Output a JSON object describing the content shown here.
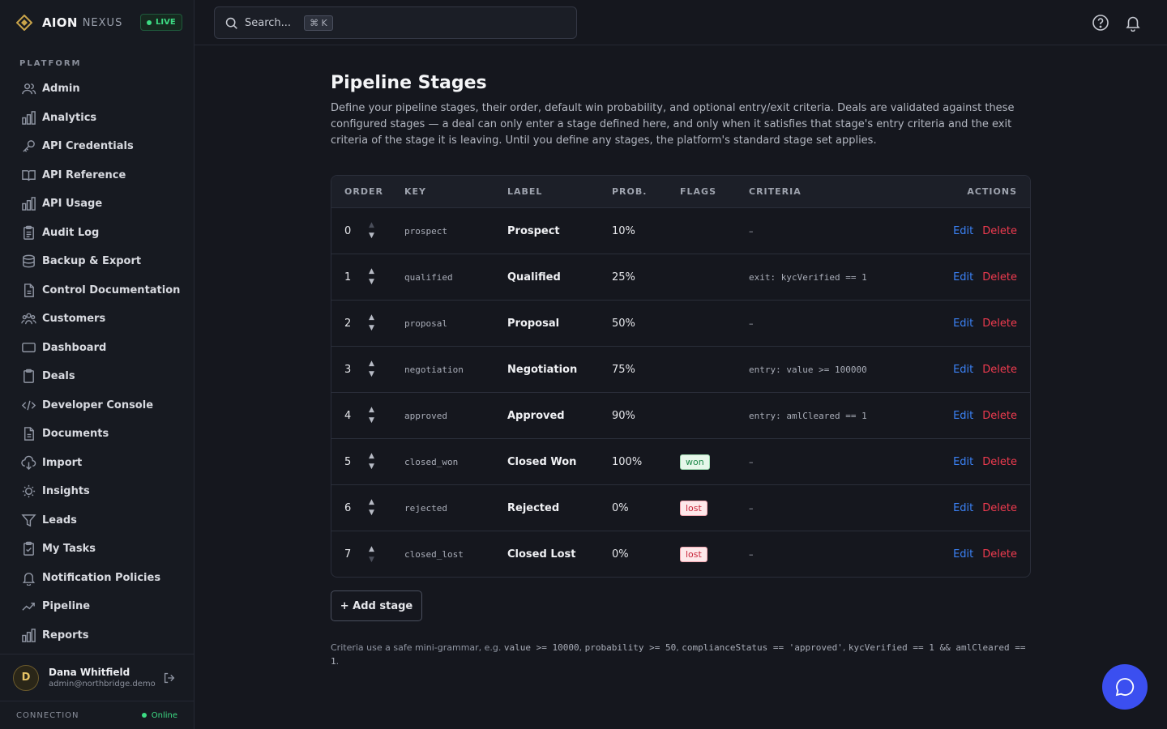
{
  "brand": {
    "name": "AION",
    "sub": "NEXUS",
    "live": "LIVE"
  },
  "sidebar": {
    "section": "PLATFORM",
    "items": [
      {
        "label": "Admin",
        "icon": "users-icon"
      },
      {
        "label": "Analytics",
        "icon": "bar-chart-icon"
      },
      {
        "label": "API Credentials",
        "icon": "key-icon"
      },
      {
        "label": "API Reference",
        "icon": "book-icon"
      },
      {
        "label": "API Usage",
        "icon": "bar-chart-icon"
      },
      {
        "label": "Audit Log",
        "icon": "clipboard-icon"
      },
      {
        "label": "Backup & Export",
        "icon": "database-icon"
      },
      {
        "label": "Control Documentation",
        "icon": "file-icon"
      },
      {
        "label": "Customers",
        "icon": "group-icon"
      },
      {
        "label": "Dashboard",
        "icon": "monitor-icon"
      },
      {
        "label": "Deals",
        "icon": "clipboard-icon"
      },
      {
        "label": "Developer Console",
        "icon": "code-icon"
      },
      {
        "label": "Documents",
        "icon": "file-icon"
      },
      {
        "label": "Import",
        "icon": "cloud-download-icon"
      },
      {
        "label": "Insights",
        "icon": "lightbulb-icon"
      },
      {
        "label": "Leads",
        "icon": "funnel-icon"
      },
      {
        "label": "My Tasks",
        "icon": "clipboard-check-icon"
      },
      {
        "label": "Notification Policies",
        "icon": "bell-icon"
      },
      {
        "label": "Pipeline",
        "icon": "trending-icon"
      },
      {
        "label": "Reports",
        "icon": "bar-chart-icon"
      }
    ]
  },
  "user": {
    "initial": "D",
    "name": "Dana Whitfield",
    "email": "admin@northbridge.demo"
  },
  "connection": {
    "label": "CONNECTION",
    "status": "Online"
  },
  "search": {
    "placeholder": "Search...",
    "shortcut": "⌘ K"
  },
  "page": {
    "title": "Pipeline Stages",
    "description": "Define your pipeline stages, their order, default win probability, and optional entry/exit criteria. Deals are validated against these configured stages — a deal can only enter a stage defined here, and only when it satisfies that stage's entry criteria and the exit criteria of the stage it is leaving. Until you define any stages, the platform's standard stage set applies."
  },
  "table": {
    "headers": {
      "order": "ORDER",
      "key": "KEY",
      "label": "LABEL",
      "prob": "PROB.",
      "flags": "FLAGS",
      "criteria": "CRITERIA",
      "actions": "ACTIONS"
    },
    "edit_label": "Edit",
    "delete_label": "Delete",
    "up_arrow": "▲",
    "down_arrow": "▼",
    "rows": [
      {
        "order": "0",
        "key": "prospect",
        "label": "Prospect",
        "prob": "10%",
        "flag": "",
        "criteria": "–"
      },
      {
        "order": "1",
        "key": "qualified",
        "label": "Qualified",
        "prob": "25%",
        "flag": "",
        "criteria": "exit: kycVerified == 1"
      },
      {
        "order": "2",
        "key": "proposal",
        "label": "Proposal",
        "prob": "50%",
        "flag": "",
        "criteria": "–"
      },
      {
        "order": "3",
        "key": "negotiation",
        "label": "Negotiation",
        "prob": "75%",
        "flag": "",
        "criteria": "entry: value >= 100000"
      },
      {
        "order": "4",
        "key": "approved",
        "label": "Approved",
        "prob": "90%",
        "flag": "",
        "criteria": "entry: amlCleared == 1"
      },
      {
        "order": "5",
        "key": "closed_won",
        "label": "Closed Won",
        "prob": "100%",
        "flag": "won",
        "criteria": "–"
      },
      {
        "order": "6",
        "key": "rejected",
        "label": "Rejected",
        "prob": "0%",
        "flag": "lost",
        "criteria": "–"
      },
      {
        "order": "7",
        "key": "closed_lost",
        "label": "Closed Lost",
        "prob": "0%",
        "flag": "lost",
        "criteria": "–"
      }
    ]
  },
  "add_button": "+ Add stage",
  "footnote": {
    "prefix": "Criteria use a safe mini-grammar, e.g. ",
    "ex1": "value >= 10000",
    "sep1": ", ",
    "ex2": "probability >= 50",
    "sep2": ", ",
    "ex3": "complianceStatus == 'approved'",
    "sep3": ", ",
    "ex4": "kycVerified == 1 && amlCleared == 1",
    "suffix": "."
  },
  "colors": {
    "accent": "#3b4ff0",
    "link": "#3b82f6",
    "danger": "#ef3b4f",
    "success": "#3ddc84"
  }
}
